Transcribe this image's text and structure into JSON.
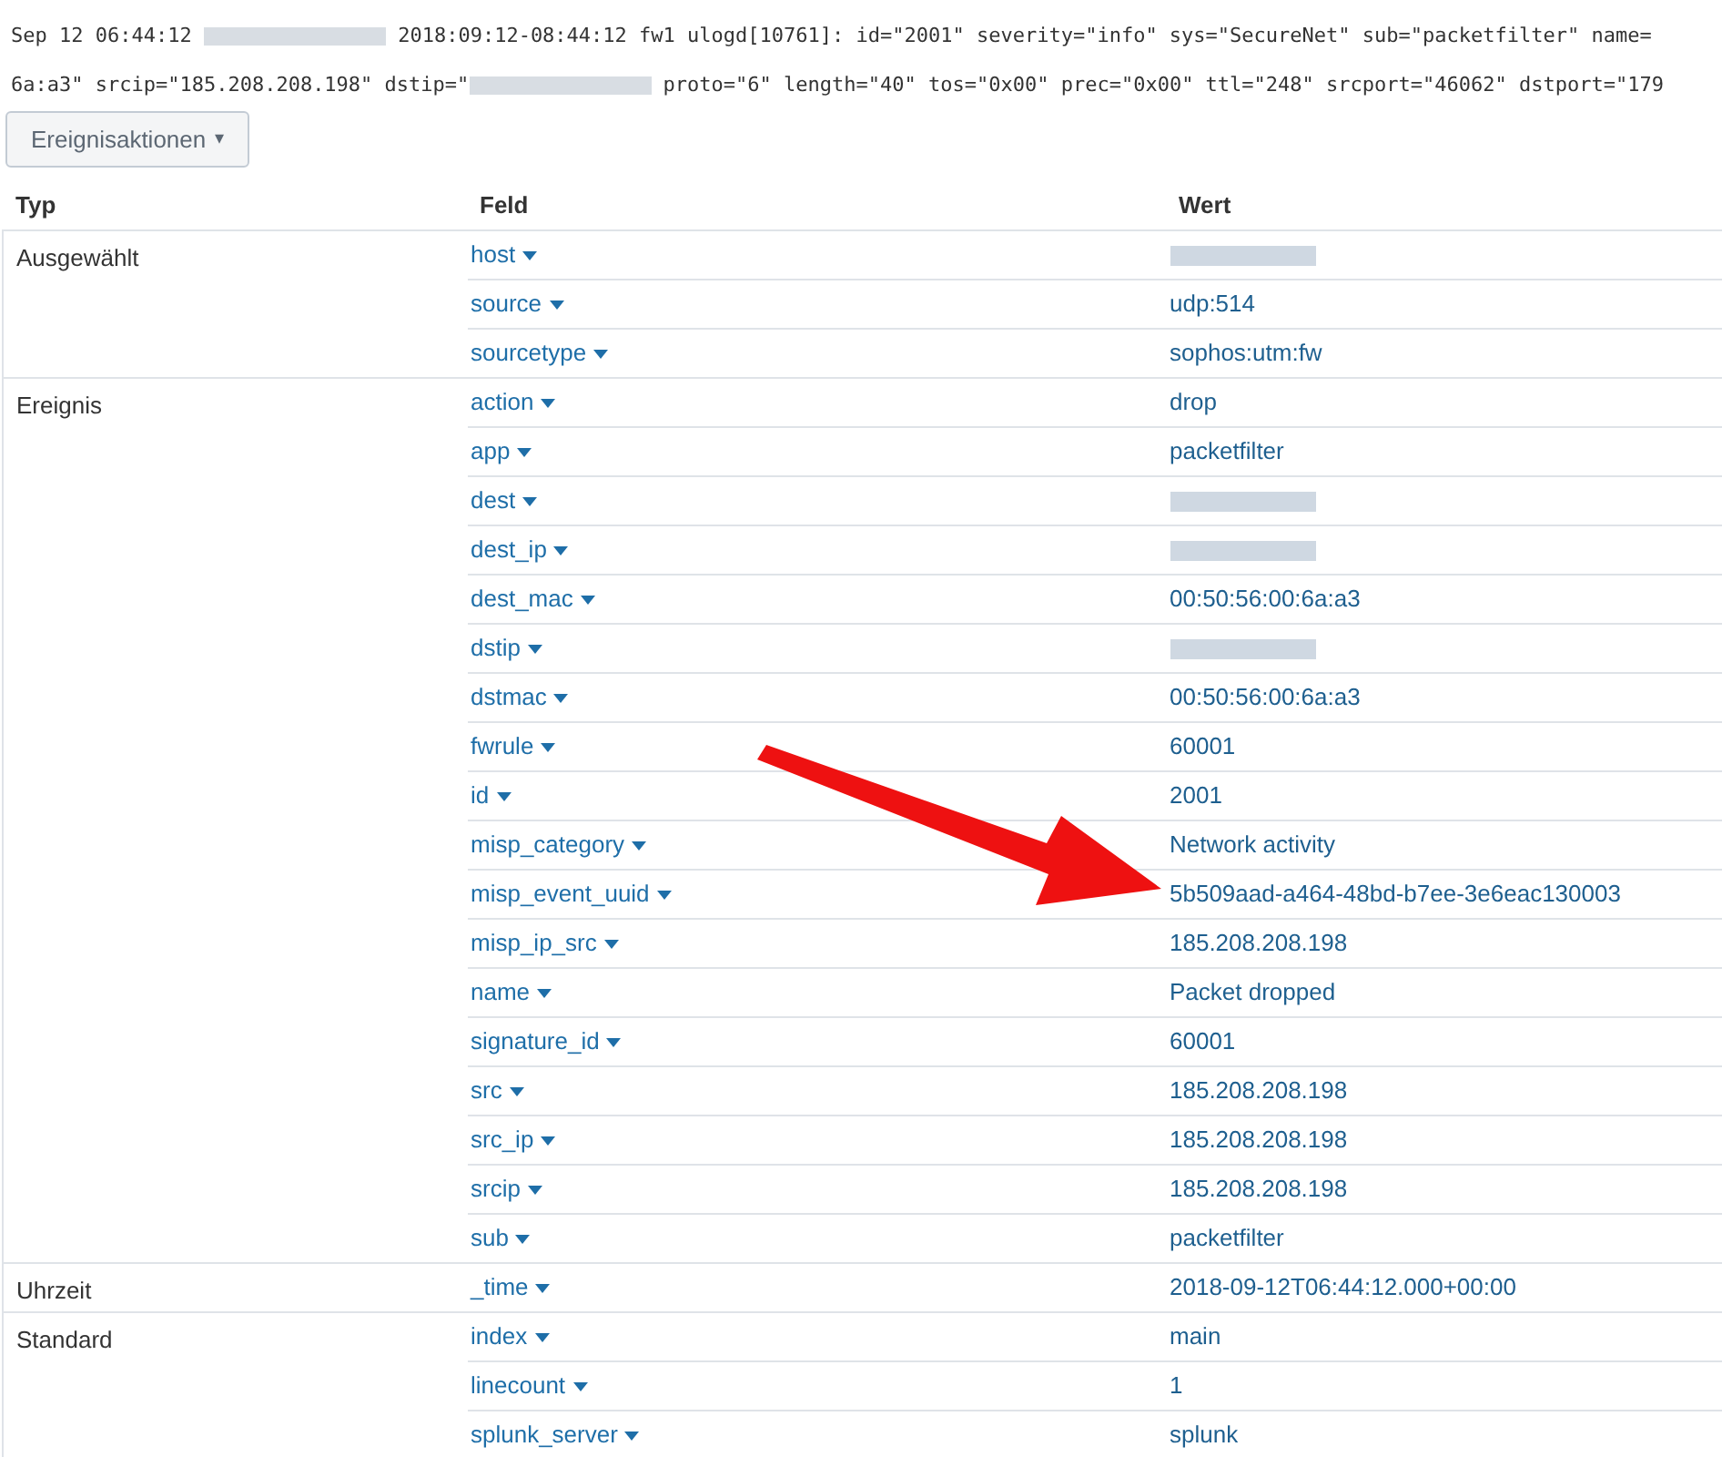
{
  "raw_event": {
    "lines": [
      [
        {
          "kind": "text",
          "text": "Sep 12 06:44:12 "
        },
        {
          "kind": "redacted"
        },
        {
          "kind": "text",
          "text": " 2018:09:12-08:44:12 fw1 ulogd[10761]: id=\"2001\" severity=\"info\" sys=\"SecureNet\" sub=\"packetfilter\" name="
        }
      ],
      [
        {
          "kind": "text",
          "text": "6a:a3\" srcip=\"185.208.208.198\" dstip=\""
        },
        {
          "kind": "redacted"
        },
        {
          "kind": "text",
          "text": " proto=\"6\" length=\"40\" tos=\"0x00\" prec=\"0x00\" ttl=\"248\" srcport=\"46062\" dstport=\"179"
        }
      ]
    ]
  },
  "actions_button": {
    "label": "Ereignisaktionen",
    "caret": "▾"
  },
  "table": {
    "columns": [
      "Typ",
      "Feld",
      "Wert"
    ],
    "groups": [
      {
        "type": "Ausgewählt",
        "rows": [
          {
            "field": "host",
            "value": null
          },
          {
            "field": "source",
            "value": "udp:514"
          },
          {
            "field": "sourcetype",
            "value": "sophos:utm:fw"
          }
        ]
      },
      {
        "type": "Ereignis",
        "rows": [
          {
            "field": "action",
            "value": "drop"
          },
          {
            "field": "app",
            "value": "packetfilter"
          },
          {
            "field": "dest",
            "value": null
          },
          {
            "field": "dest_ip",
            "value": null
          },
          {
            "field": "dest_mac",
            "value": "00:50:56:00:6a:a3"
          },
          {
            "field": "dstip",
            "value": null
          },
          {
            "field": "dstmac",
            "value": "00:50:56:00:6a:a3"
          },
          {
            "field": "fwrule",
            "value": "60001"
          },
          {
            "field": "id",
            "value": "2001"
          },
          {
            "field": "misp_category",
            "value": "Network activity"
          },
          {
            "field": "misp_event_uuid",
            "value": "5b509aad-a464-48bd-b7ee-3e6eac130003"
          },
          {
            "field": "misp_ip_src",
            "value": "185.208.208.198"
          },
          {
            "field": "name",
            "value": "Packet dropped"
          },
          {
            "field": "signature_id",
            "value": "60001"
          },
          {
            "field": "src",
            "value": "185.208.208.198"
          },
          {
            "field": "src_ip",
            "value": "185.208.208.198"
          },
          {
            "field": "srcip",
            "value": "185.208.208.198"
          },
          {
            "field": "sub",
            "value": "packetfilter"
          }
        ]
      },
      {
        "type": "Uhrzeit",
        "rows": [
          {
            "field": "_time",
            "value": "2018-09-12T06:44:12.000+00:00"
          }
        ]
      },
      {
        "type": "Standard",
        "rows": [
          {
            "field": "index",
            "value": "main"
          },
          {
            "field": "linecount",
            "value": "1"
          },
          {
            "field": "splunk_server",
            "value": "splunk"
          }
        ]
      }
    ]
  },
  "annotation": {
    "kind": "arrow"
  }
}
